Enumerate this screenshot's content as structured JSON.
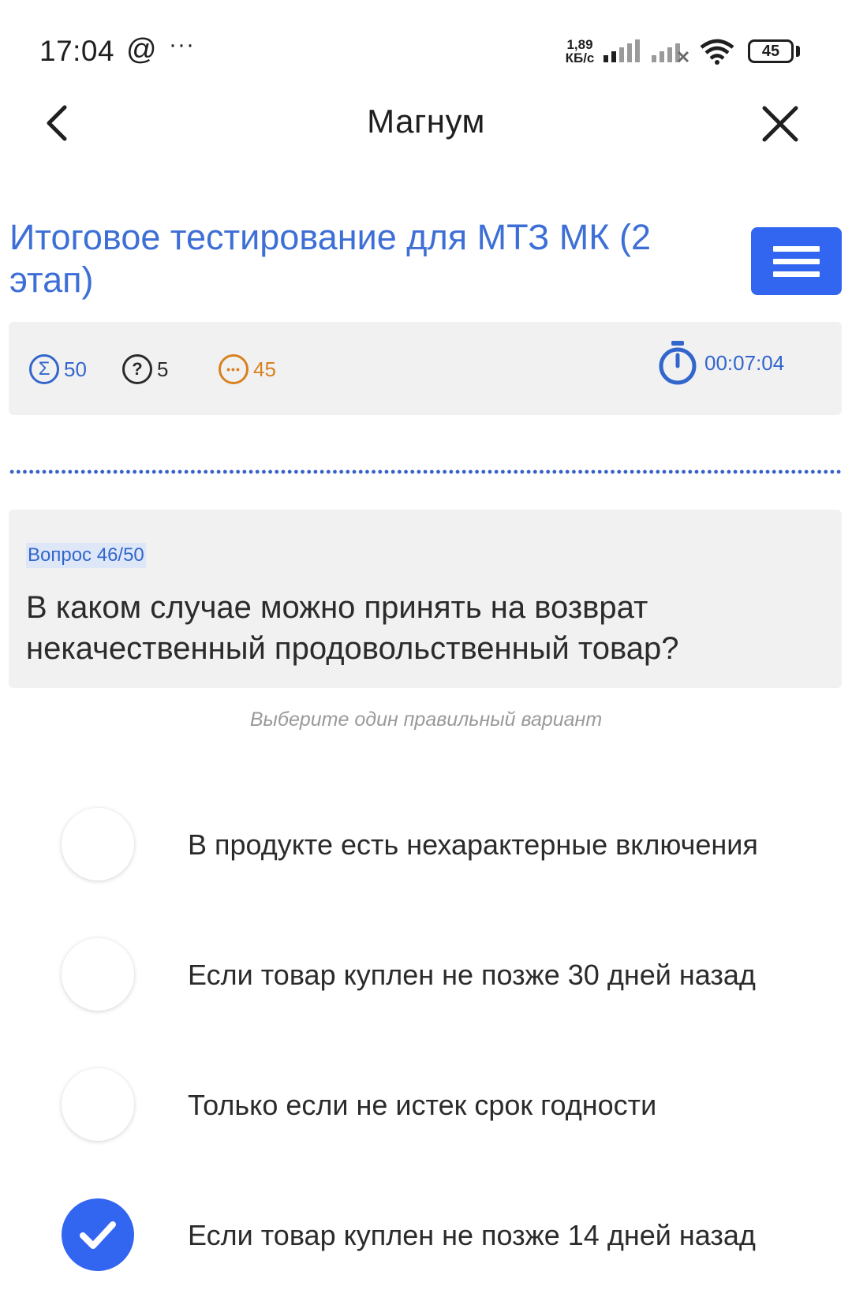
{
  "status_bar": {
    "time": "17:04",
    "at_symbol": "@",
    "more_dots": "···",
    "speed_value": "1,89",
    "speed_unit": "КБ/с",
    "battery": "45"
  },
  "header": {
    "title": "Магнум",
    "back_icon": "chevron-left-icon",
    "close_icon": "close-icon"
  },
  "test": {
    "title": "Итоговое тестирование для МТЗ МК (2 этап)",
    "menu_icon": "hamburger-menu-icon"
  },
  "stats": {
    "total": "50",
    "answered": "5",
    "remaining": "45",
    "timer": "00:07:04",
    "colors": {
      "blue": "#3366cc",
      "orange": "#d9811f",
      "dark": "#2b2b2b"
    }
  },
  "question": {
    "number_label": "Вопрос 46/50",
    "text": "В каком случае можно принять на возврат некачественный продовольственный товар?",
    "hint": "Выберите один правильный вариант"
  },
  "options": [
    {
      "label": "В продукте есть нехарактерные включения",
      "checked": false
    },
    {
      "label": "Если товар куплен не позже 30 дней назад",
      "checked": false
    },
    {
      "label": "Только если не истек срок годности",
      "checked": false
    },
    {
      "label": "Если товар куплен не позже 14 дней назад",
      "checked": true
    }
  ],
  "accent_color": "#3366f0"
}
